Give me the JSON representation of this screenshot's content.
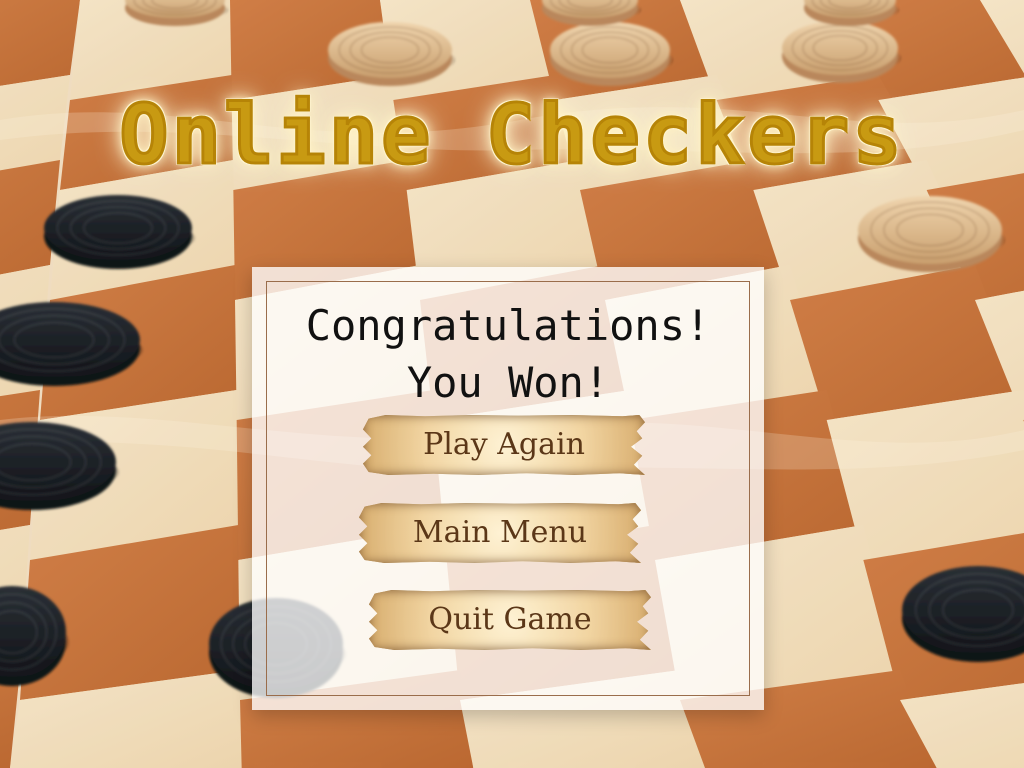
{
  "title": "Online Checkers",
  "message": {
    "line1": "Congratulations!",
    "line2": "You Won!"
  },
  "buttons": {
    "play_again": "Play Again",
    "main_menu": "Main Menu",
    "quit_game": "Quit Game"
  },
  "colors": {
    "title": "#c89a12",
    "title_outline": "#b68407",
    "panel": "#ffffff",
    "button_text": "#5b3718",
    "board_dark": "#c7733d",
    "board_light": "#f2dec0",
    "black_piece": "#1e2328",
    "white_piece": "#d8b58b"
  }
}
